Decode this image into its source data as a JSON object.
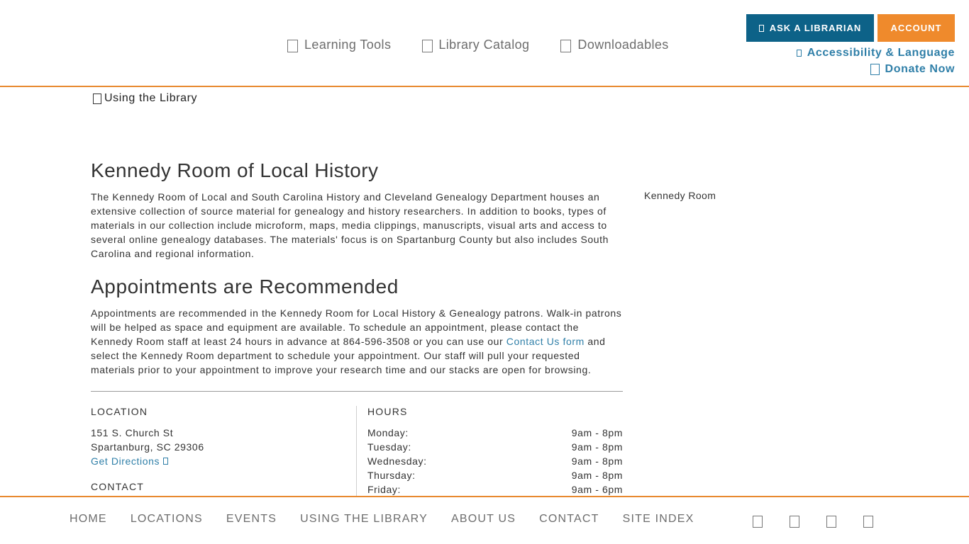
{
  "header": {
    "nav": [
      {
        "label": "Learning Tools"
      },
      {
        "label": "Library Catalog"
      },
      {
        "label": "Downloadables"
      }
    ],
    "ask_label": "ASK A LIBRARIAN",
    "account_label": "ACCOUNT",
    "accessibility_label": "Accessibility & Language",
    "donate_label": "Donate Now"
  },
  "subnav": {
    "label": "Using the Library"
  },
  "content": {
    "title": "Kennedy Room of Local History",
    "intro": "The Kennedy Room of Local and South Carolina History and Cleveland Genealogy Department houses an extensive collection of source material for genealogy and history researchers. In addition to books, types of materials in our collection include microform, maps, media clippings, manuscripts, visual arts and access to several online genealogy databases. The materials' focus is on Spartanburg County but also includes South Carolina and regional information.",
    "appt_heading": "Appointments are Recommended",
    "appt_text_1": "Appointments are recommended in the Kennedy Room for Local History & Genealogy patrons. Walk-in patrons will be helped as space and equipment are available. To schedule an appointment, please contact the Kennedy Room staff at least 24 hours in advance at 864-596-3508 or you can use our ",
    "appt_link": "Contact Us form",
    "appt_text_2": " and select the Kennedy Room department to schedule your appointment. Our staff will pull your requested materials prior to your appointment to improve your research time and our stacks are open for browsing.",
    "image_alt": "Kennedy Room"
  },
  "location": {
    "heading": "LOCATION",
    "street": "151 S. Church St",
    "city": "Spartanburg, SC 29306",
    "directions": "Get Directions",
    "contact_heading": "CONTACT"
  },
  "hours": {
    "heading": "HOURS",
    "rows": [
      {
        "day": "Monday:",
        "time": "9am - 8pm"
      },
      {
        "day": "Tuesday:",
        "time": "9am - 8pm"
      },
      {
        "day": "Wednesday:",
        "time": "9am - 8pm"
      },
      {
        "day": "Thursday:",
        "time": "9am - 8pm"
      },
      {
        "day": "Friday:",
        "time": "9am - 6pm"
      }
    ]
  },
  "footer": {
    "nav": [
      {
        "label": "HOME"
      },
      {
        "label": "LOCATIONS"
      },
      {
        "label": "EVENTS"
      },
      {
        "label": "USING THE LIBRARY"
      },
      {
        "label": "ABOUT US"
      },
      {
        "label": "CONTACT"
      },
      {
        "label": "SITE INDEX"
      }
    ],
    "social_icons": [
      "facebook-icon",
      "twitter-icon",
      "instagram-icon",
      "youtube-icon"
    ]
  }
}
